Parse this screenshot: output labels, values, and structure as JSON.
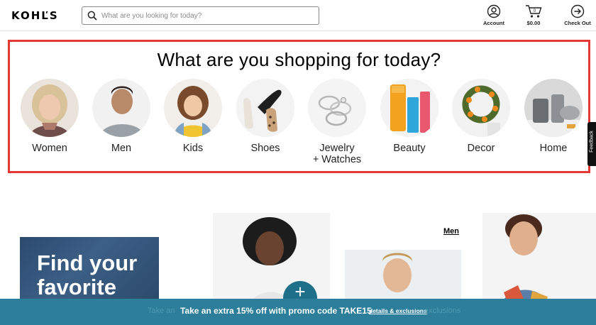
{
  "header": {
    "logo": "KOHĽS",
    "search_placeholder": "What are you looking for today?",
    "account_label": "Account",
    "cart_label": "$0.00",
    "cart_count": "0",
    "checkout_label": "Check Out"
  },
  "categories": {
    "title": "What are you shopping for today?",
    "items": [
      {
        "label": "Women"
      },
      {
        "label": "Men"
      },
      {
        "label": "Kids"
      },
      {
        "label": "Shoes"
      },
      {
        "label": "Jewelry",
        "label2": "+ Watches"
      },
      {
        "label": "Beauty"
      },
      {
        "label": "Decor"
      },
      {
        "label": "Home"
      }
    ]
  },
  "feedback_label": "Feedback",
  "promos": {
    "denim_line1": "Find your",
    "denim_line2": "favorite",
    "men_link": "Men"
  },
  "promo_bar": {
    "ghost_left": "Take an",
    "message": "Take an extra 15% off with promo code TAKE15",
    "details_link": "details & exclusions",
    "ghost_right": "exclusions"
  },
  "colors": {
    "highlight_border": "#e53935",
    "promo_bar": "#2c7e9a",
    "plus_button": "#1e6f8a"
  }
}
